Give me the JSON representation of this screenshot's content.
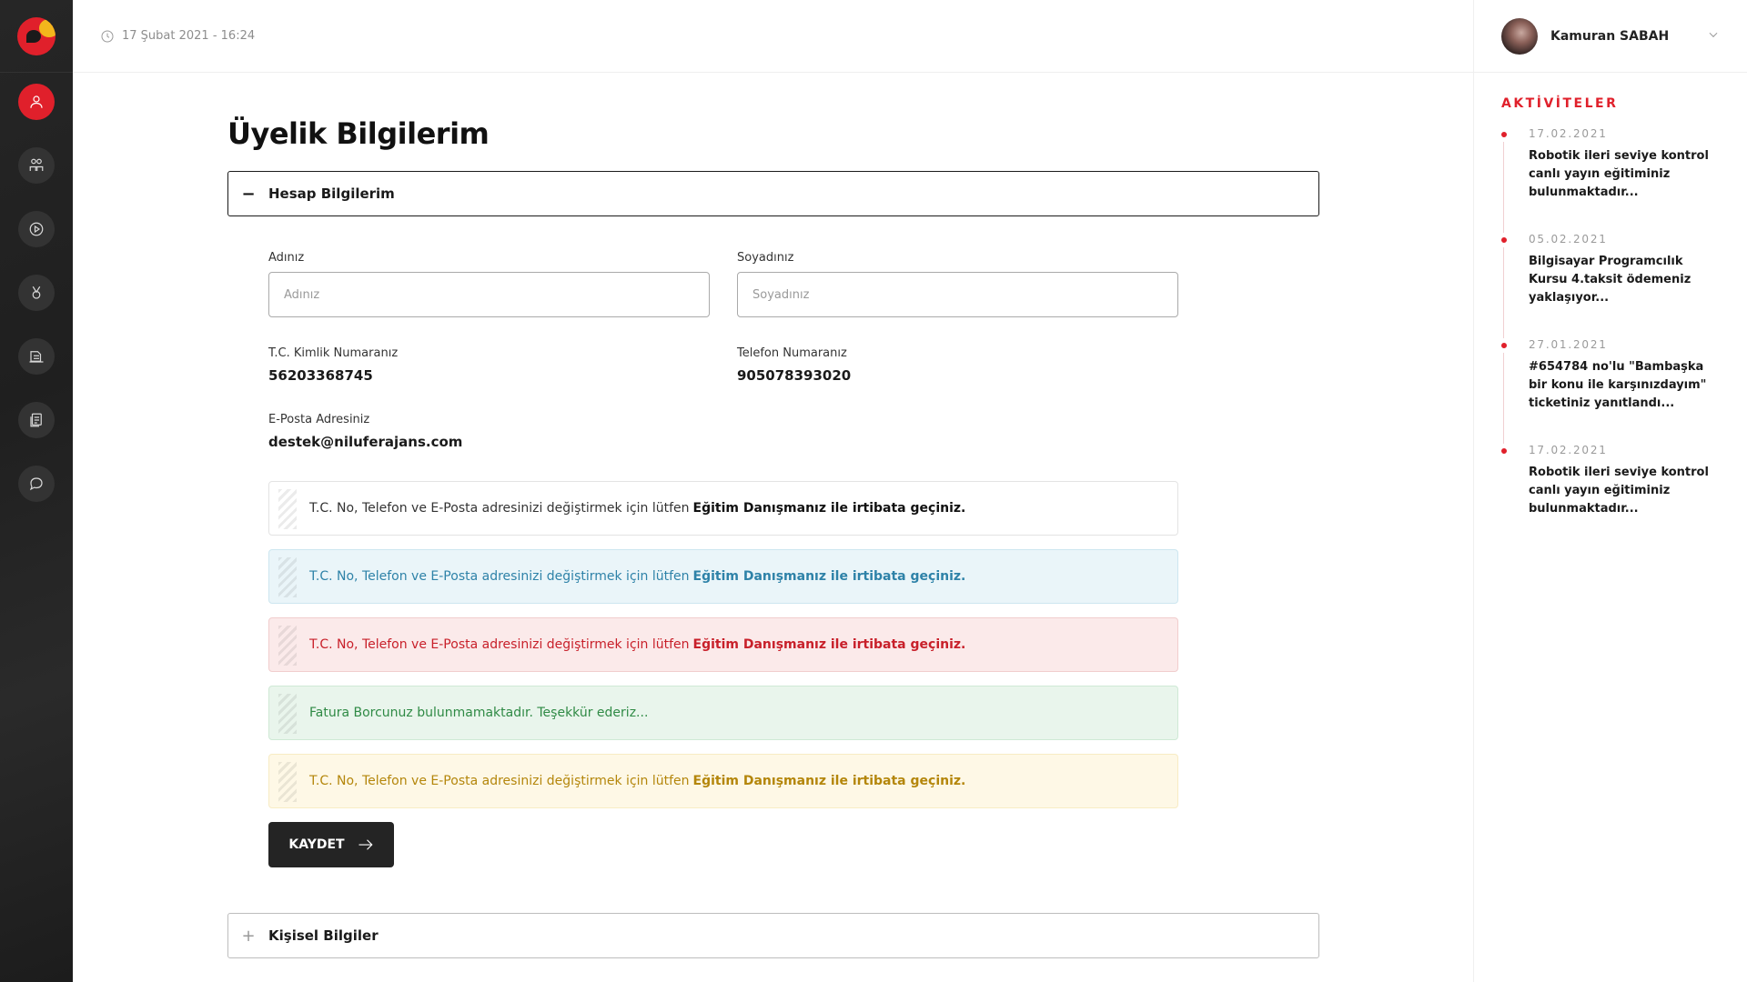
{
  "topbar": {
    "datetime": "17 Şubat 2021 - 16:24"
  },
  "user": {
    "name": "Kamuran SABAH"
  },
  "sidebar": {
    "items": [
      {
        "icon": "user-icon",
        "active": true
      },
      {
        "icon": "students-icon",
        "active": false
      },
      {
        "icon": "play-icon",
        "active": false
      },
      {
        "icon": "medal-icon",
        "active": false
      },
      {
        "icon": "books-icon",
        "active": false
      },
      {
        "icon": "documents-icon",
        "active": false
      },
      {
        "icon": "chat-icon",
        "active": false
      }
    ]
  },
  "page": {
    "title": "Üyelik Bilgilerim"
  },
  "account": {
    "header": "Hesap Bilgilerim",
    "first_name": {
      "label": "Adınız",
      "placeholder": "Adınız"
    },
    "last_name": {
      "label": "Soyadınız",
      "placeholder": "Soyadınız"
    },
    "tc": {
      "label": "T.C. Kimlik Numaranız",
      "value": "56203368745"
    },
    "phone": {
      "label": "Telefon Numaranız",
      "value": "905078393020"
    },
    "email": {
      "label": "E-Posta Adresiniz",
      "value": "destek@niluferajans.com"
    },
    "alerts": {
      "plain": {
        "text": "T.C. No, Telefon ve E-Posta adresinizi değiştirmek için lütfen",
        "strong": "Eğitim Danışmanız ile irtibata geçiniz."
      },
      "info": {
        "text": "T.C. No, Telefon ve E-Posta adresinizi değiştirmek için lütfen",
        "strong": "Eğitim Danışmanız ile irtibata geçiniz."
      },
      "danger": {
        "text": "T.C. No, Telefon ve E-Posta adresinizi değiştirmek için lütfen",
        "strong": "Eğitim Danışmanız ile irtibata geçiniz."
      },
      "success": {
        "text": "Fatura Borcunuz bulunmamaktadır. Teşekkür ederiz..."
      },
      "warning": {
        "text": "T.C. No, Telefon ve E-Posta adresinizi değiştirmek için lütfen",
        "strong": "Eğitim Danışmanız ile irtibata geçiniz."
      }
    },
    "save_label": "KAYDET"
  },
  "personal": {
    "header": "Kişisel Bilgiler"
  },
  "activities": {
    "title": "AKTİVİTELER",
    "items": [
      {
        "date": "17.02.2021",
        "text": "Robotik ileri seviye kontrol canlı yayın eğitiminiz bulunmaktadır..."
      },
      {
        "date": "05.02.2021",
        "text": "Bilgisayar Programcılık Kursu 4.taksit ödemeniz yaklaşıyor..."
      },
      {
        "date": "27.01.2021",
        "text": "#654784 no'lu \"Bambaşka bir konu ile karşınızdayım\" ticketiniz yanıtlandı..."
      },
      {
        "date": "17.02.2021",
        "text": "Robotik ileri seviye kontrol canlı yayın eğitiminiz bulunmaktadır..."
      }
    ]
  },
  "colors": {
    "accent": "#e0202b",
    "sidebar": "#222222"
  }
}
